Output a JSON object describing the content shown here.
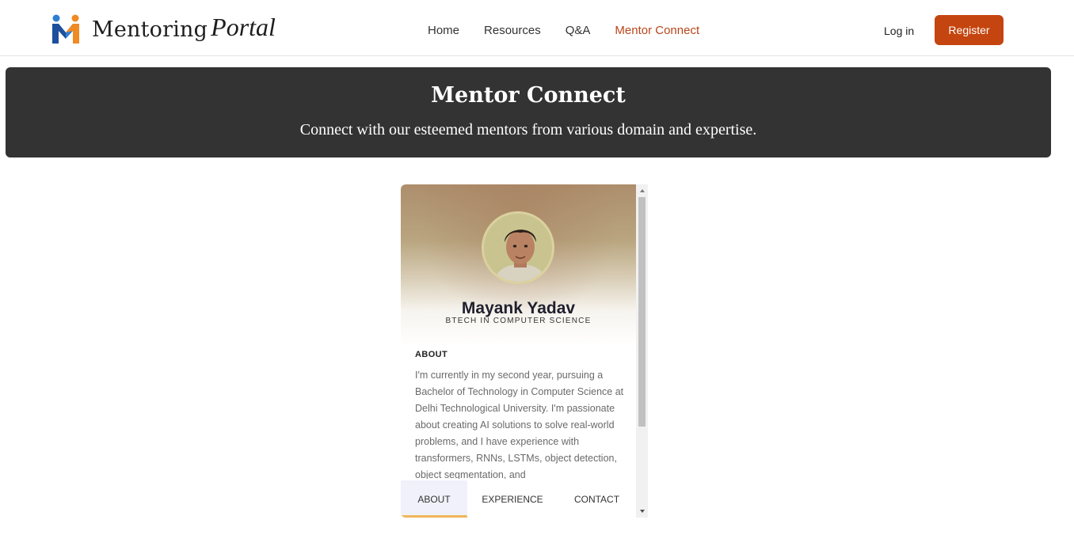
{
  "brand": {
    "name_part1": "Mentoring",
    "name_part2": "Portal",
    "logo_colors": {
      "blue": "#2f7fd1",
      "orange": "#f08a24",
      "navy": "#1e4f9c"
    }
  },
  "nav": {
    "items": [
      {
        "label": "Home"
      },
      {
        "label": "Resources"
      },
      {
        "label": "Q&A"
      },
      {
        "label": "Mentor Connect",
        "active": true
      }
    ],
    "active_color": "#b8461b"
  },
  "auth": {
    "login_label": "Log in",
    "register_label": "Register",
    "register_color": "#c4450f"
  },
  "hero": {
    "title": "Mentor Connect",
    "subtitle": "Connect with our esteemed mentors from various domain and expertise."
  },
  "mentor_card": {
    "name": "Mayank Yadav",
    "degree": "BTECH IN COMPUTER SCIENCE",
    "about_heading": "ABOUT",
    "about_text": "I'm currently in my second year, pursuing a Bachelor of Technology in Computer Science at Delhi Technological University. I'm passionate about creating AI solutions to solve real-world problems, and I have experience with transformers, RNNs, LSTMs, object detection, object segmentation, and",
    "tabs": [
      {
        "label": "ABOUT",
        "active": true
      },
      {
        "label": "EXPERIENCE"
      },
      {
        "label": "CONTACT"
      }
    ],
    "tab_accent": "#f0b55a"
  }
}
